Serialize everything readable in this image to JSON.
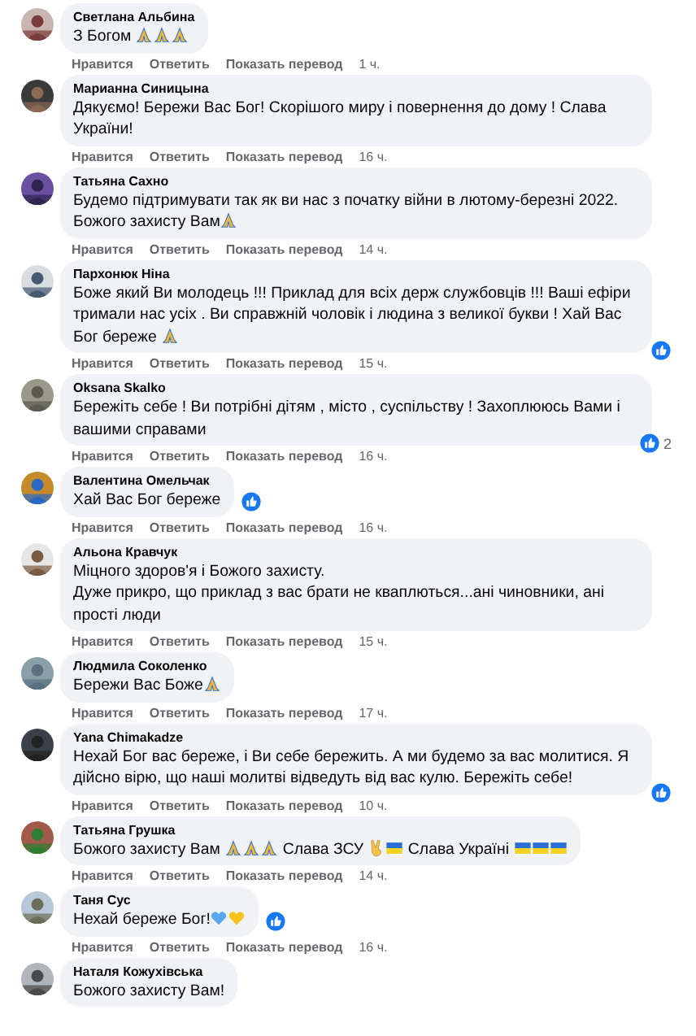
{
  "comments": [
    {
      "author": "Светлана Альбина",
      "message": [
        {
          "kind": "text",
          "text": "З Богом "
        },
        {
          "kind": "pray"
        },
        {
          "kind": "pray"
        },
        {
          "kind": "pray"
        }
      ],
      "actions": [
        "Нравится",
        "Ответить",
        "Показать перевод"
      ],
      "time": "1 ч."
    },
    {
      "author": "Марианна Синицына",
      "message": [
        {
          "kind": "text",
          "text": "Дякуємо! Бережи Вас Бог! Скорішого миру і повернення до дому ! Слава України!"
        }
      ],
      "actions": [
        "Нравится",
        "Ответить",
        "Показать перевод"
      ],
      "time": "16 ч."
    },
    {
      "author": "Татьяна Сахно",
      "message": [
        {
          "kind": "text",
          "text": "Будемо підтримувати так як ви нас з початку війни в лютому-березні 2022. Божого захисту Вам"
        },
        {
          "kind": "pray"
        }
      ],
      "actions": [
        "Нравится",
        "Ответить",
        "Показать перевод"
      ],
      "time": "14 ч."
    },
    {
      "author": "Пархонюк Ніна",
      "message": [
        {
          "kind": "text",
          "text": "Боже який Ви молодець !!! Приклад для всіх держ службовців !!! Ваші ефіри тримали нас усіх . Ви справжній чоловік і людина з великої букви ! Хай Вас Бог береже "
        },
        {
          "kind": "pray"
        }
      ],
      "actions": [
        "Нравится",
        "Ответить",
        "Показать перевод"
      ],
      "time": "15 ч.",
      "reaction": {
        "kind": "like"
      }
    },
    {
      "author": "Oksana Skalko",
      "message": [
        {
          "kind": "text",
          "text": "Бережіть себе ! Ви потрібні дітям , місто , суспільству ! Захоплююсь Вами і вашими справами"
        }
      ],
      "actions": [
        "Нравится",
        "Ответить",
        "Показать перевод"
      ],
      "time": "16 ч.",
      "reaction": {
        "kind": "like",
        "count": "2"
      }
    },
    {
      "author": "Валентина Омельчак",
      "message": [
        {
          "kind": "text",
          "text": "Хай Вас Бог береже"
        }
      ],
      "actions": [
        "Нравится",
        "Ответить",
        "Показать перевод"
      ],
      "time": "16 ч.",
      "reaction": {
        "kind": "like"
      }
    },
    {
      "author": "Альона Кравчук",
      "message": [
        {
          "kind": "text",
          "text": "Міцного здоров'я і Божого захисту.\nДуже прикро, що приклад з вас брати не кваплються...ані чиновники, ані прості люди"
        }
      ],
      "actions": [
        "Нравится",
        "Ответить",
        "Показать перевод"
      ],
      "time": "15 ч."
    },
    {
      "author": "Людмила Соколенко",
      "message": [
        {
          "kind": "text",
          "text": "Бережи Вас Боже"
        },
        {
          "kind": "pray"
        }
      ],
      "actions": [
        "Нравится",
        "Ответить",
        "Показать перевод"
      ],
      "time": "17 ч."
    },
    {
      "author": "Yana Chimakadze",
      "message": [
        {
          "kind": "text",
          "text": "Нехай Бог вас береже, і Ви себе бережить. А ми будемо за вас молитися. Я дійсно вірю, що наші молитві відведуть від вас кулю. Бережіть себе!"
        }
      ],
      "actions": [
        "Нравится",
        "Ответить",
        "Показать перевод"
      ],
      "time": "10 ч.",
      "reaction": {
        "kind": "like"
      }
    },
    {
      "author": "Татьяна Грушка",
      "message": [
        {
          "kind": "text",
          "text": "Божого захисту Вам "
        },
        {
          "kind": "pray"
        },
        {
          "kind": "pray"
        },
        {
          "kind": "pray"
        },
        {
          "kind": "text",
          "text": " Слава ЗСУ "
        },
        {
          "kind": "victory"
        },
        {
          "kind": "flag"
        },
        {
          "kind": "text",
          "text": " Слава Україні "
        },
        {
          "kind": "flag"
        },
        {
          "kind": "flag"
        },
        {
          "kind": "flag"
        }
      ],
      "actions": [
        "Нравится",
        "Ответить",
        "Показать перевод"
      ],
      "time": "14 ч."
    },
    {
      "author": "Таня Сус",
      "message": [
        {
          "kind": "text",
          "text": "Нехай береже Бог!"
        },
        {
          "kind": "blue-heart"
        },
        {
          "kind": "yellow-heart"
        }
      ],
      "actions": [
        "Нравится",
        "Ответить",
        "Показать перевод"
      ],
      "time": "16 ч.",
      "reaction": {
        "kind": "like"
      }
    },
    {
      "author": "Наталя Кожухівська",
      "message": [
        {
          "kind": "text",
          "text": "Божого захисту Вам!"
        }
      ]
    }
  ]
}
